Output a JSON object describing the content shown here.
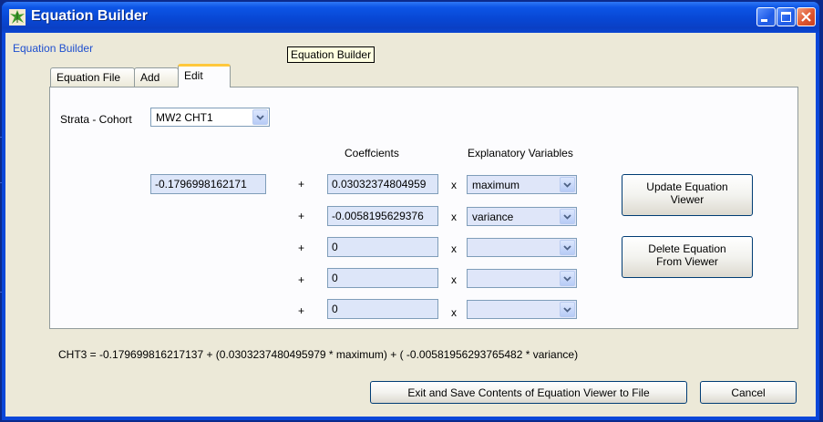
{
  "window": {
    "title": "Equation Builder"
  },
  "group_title": "Equation Builder",
  "tooltip": "Equation Builder",
  "tabs": [
    {
      "label": "Equation File",
      "active": false
    },
    {
      "label": "Add",
      "active": false
    },
    {
      "label": "Edit",
      "active": true
    }
  ],
  "strata": {
    "label": "Strata - Cohort",
    "value": "MW2 CHT1"
  },
  "headers": {
    "coefficients": "Coeffcients",
    "variables": "Explanatory Variables"
  },
  "intercept": "-0.1796998162171",
  "rows": [
    {
      "op": "+",
      "coef": "0.03032374804959",
      "x": "x",
      "var": "maximum"
    },
    {
      "op": "+",
      "coef": "-0.0058195629376",
      "x": "x",
      "var": "variance"
    },
    {
      "op": "+",
      "coef": "0",
      "x": "x",
      "var": ""
    },
    {
      "op": "+",
      "coef": "0",
      "x": "x",
      "var": ""
    },
    {
      "op": "+",
      "coef": "0",
      "x": "x",
      "var": ""
    }
  ],
  "buttons": {
    "update": "Update Equation Viewer",
    "delete": "Delete Equation From Viewer",
    "exit_save": "Exit and Save Contents of Equation Viewer to File",
    "cancel": "Cancel"
  },
  "equation_text": "CHT3 = -0.179699816217137  + (0.0303237480495979 * maximum) + ( -0.00581956293765482 * variance)",
  "colors": {
    "titlebar": "#0847d4",
    "client": "#ece9d8",
    "accent_label": "#1e4fcf",
    "tab_highlight": "#ffc83c"
  }
}
